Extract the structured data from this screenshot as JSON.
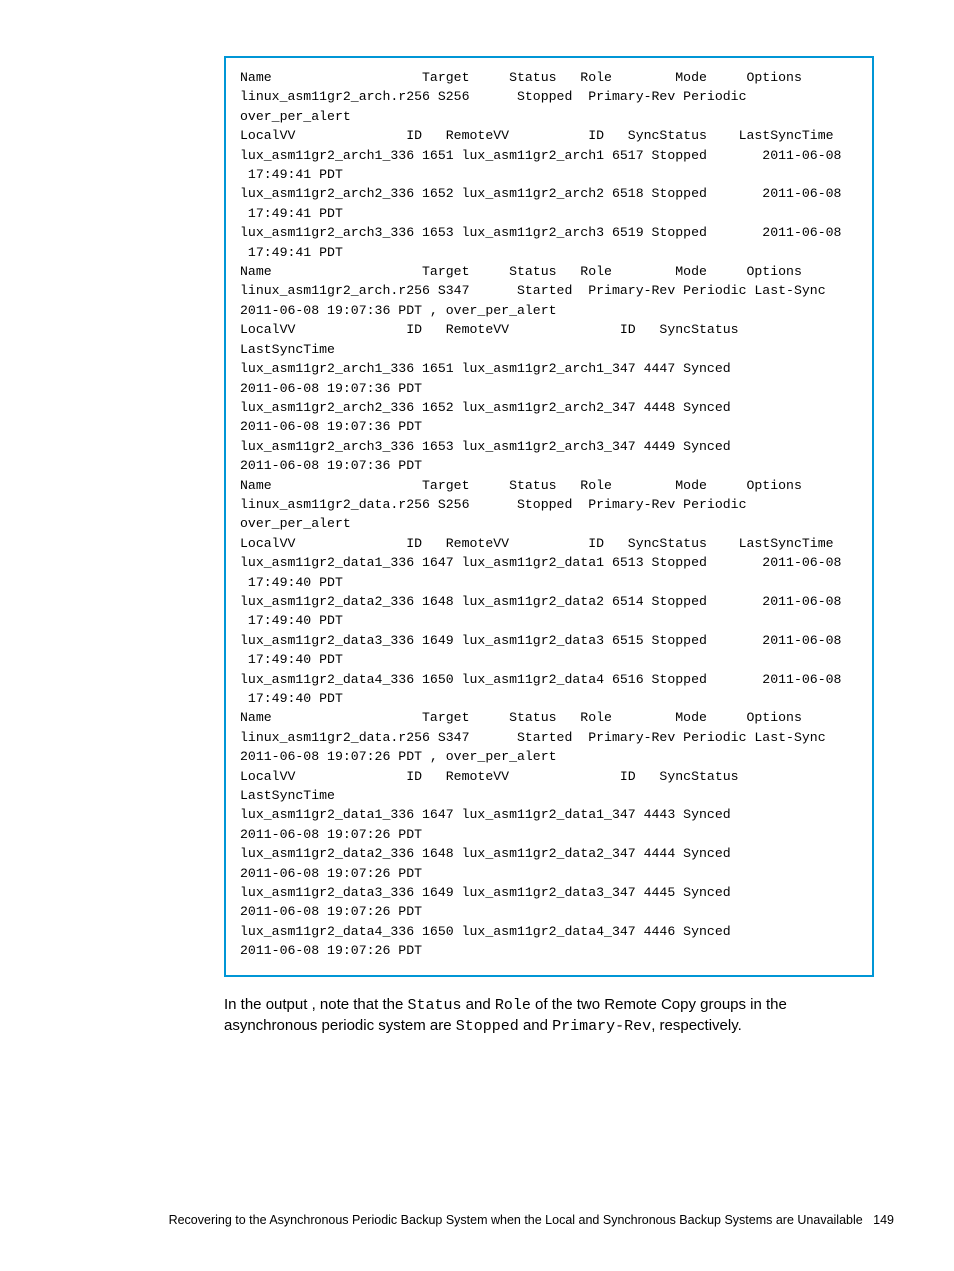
{
  "code_block": "Name                   Target     Status   Role        Mode     Options\nlinux_asm11gr2_arch.r256 S256      Stopped  Primary-Rev Periodic\nover_per_alert\nLocalVV              ID   RemoteVV          ID   SyncStatus    LastSyncTime\nlux_asm11gr2_arch1_336 1651 lux_asm11gr2_arch1 6517 Stopped       2011-06-08\n 17:49:41 PDT\nlux_asm11gr2_arch2_336 1652 lux_asm11gr2_arch2 6518 Stopped       2011-06-08\n 17:49:41 PDT\nlux_asm11gr2_arch3_336 1653 lux_asm11gr2_arch3 6519 Stopped       2011-06-08\n 17:49:41 PDT\nName                   Target     Status   Role        Mode     Options\nlinux_asm11gr2_arch.r256 S347      Started  Primary-Rev Periodic Last-Sync\n2011-06-08 19:07:36 PDT , over_per_alert\nLocalVV              ID   RemoteVV              ID   SyncStatus\nLastSyncTime\nlux_asm11gr2_arch1_336 1651 lux_asm11gr2_arch1_347 4447 Synced\n2011-06-08 19:07:36 PDT\nlux_asm11gr2_arch2_336 1652 lux_asm11gr2_arch2_347 4448 Synced\n2011-06-08 19:07:36 PDT\nlux_asm11gr2_arch3_336 1653 lux_asm11gr2_arch3_347 4449 Synced\n2011-06-08 19:07:36 PDT\nName                   Target     Status   Role        Mode     Options\nlinux_asm11gr2_data.r256 S256      Stopped  Primary-Rev Periodic\nover_per_alert\nLocalVV              ID   RemoteVV          ID   SyncStatus    LastSyncTime\nlux_asm11gr2_data1_336 1647 lux_asm11gr2_data1 6513 Stopped       2011-06-08\n 17:49:40 PDT\nlux_asm11gr2_data2_336 1648 lux_asm11gr2_data2 6514 Stopped       2011-06-08\n 17:49:40 PDT\nlux_asm11gr2_data3_336 1649 lux_asm11gr2_data3 6515 Stopped       2011-06-08\n 17:49:40 PDT\nlux_asm11gr2_data4_336 1650 lux_asm11gr2_data4 6516 Stopped       2011-06-08\n 17:49:40 PDT\nName                   Target     Status   Role        Mode     Options\nlinux_asm11gr2_data.r256 S347      Started  Primary-Rev Periodic Last-Sync\n2011-06-08 19:07:26 PDT , over_per_alert\nLocalVV              ID   RemoteVV              ID   SyncStatus\nLastSyncTime\nlux_asm11gr2_data1_336 1647 lux_asm11gr2_data1_347 4443 Synced\n2011-06-08 19:07:26 PDT\nlux_asm11gr2_data2_336 1648 lux_asm11gr2_data2_347 4444 Synced\n2011-06-08 19:07:26 PDT\nlux_asm11gr2_data3_336 1649 lux_asm11gr2_data3_347 4445 Synced\n2011-06-08 19:07:26 PDT\nlux_asm11gr2_data4_336 1650 lux_asm11gr2_data4_347 4446 Synced\n2011-06-08 19:07:26 PDT",
  "paragraph": {
    "p1": "In the output , note that the ",
    "m1": "Status",
    "p2": " and ",
    "m2": "Role",
    "p3": " of the two Remote Copy groups in the asynchronous periodic system are ",
    "m3": "Stopped",
    "p4": " and ",
    "m4": "Primary-Rev",
    "p5": ", respectively."
  },
  "footer": {
    "title": "Recovering to the Asynchronous Periodic Backup System when the Local and Synchronous Backup Systems are Unavailable",
    "page": "149"
  }
}
